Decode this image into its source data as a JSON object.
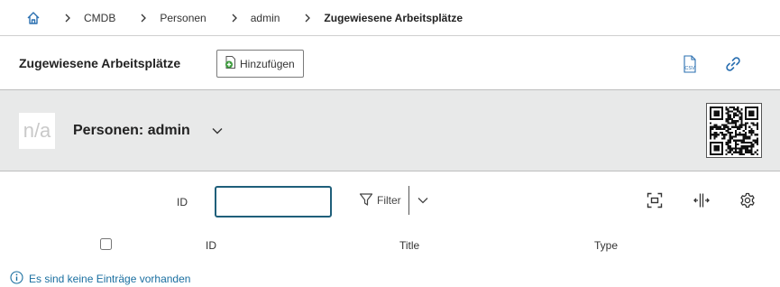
{
  "breadcrumb": {
    "home_icon": "home-icon",
    "items": [
      "CMDB",
      "Personen",
      "admin"
    ],
    "current": "Zugewiesene Arbeitsplätze"
  },
  "toolbar": {
    "title": "Zugewiesene Arbeitsplätze",
    "add_label": "Hinzufügen",
    "csv_icon_text": "CSV"
  },
  "object_header": {
    "image_placeholder": "n/a",
    "title": "Personen: admin",
    "background_color": "#e8e9e9"
  },
  "filter": {
    "field_label": "ID",
    "input_value": "",
    "filter_label": "Filter",
    "focus_color": "#1f5f7a"
  },
  "table": {
    "columns": [
      "ID",
      "Title",
      "Type"
    ]
  },
  "empty_message": "Es sind keine Einträge vorhanden",
  "colors": {
    "link_blue": "#1a6fa0",
    "icon_blue": "#2a6fb0"
  }
}
